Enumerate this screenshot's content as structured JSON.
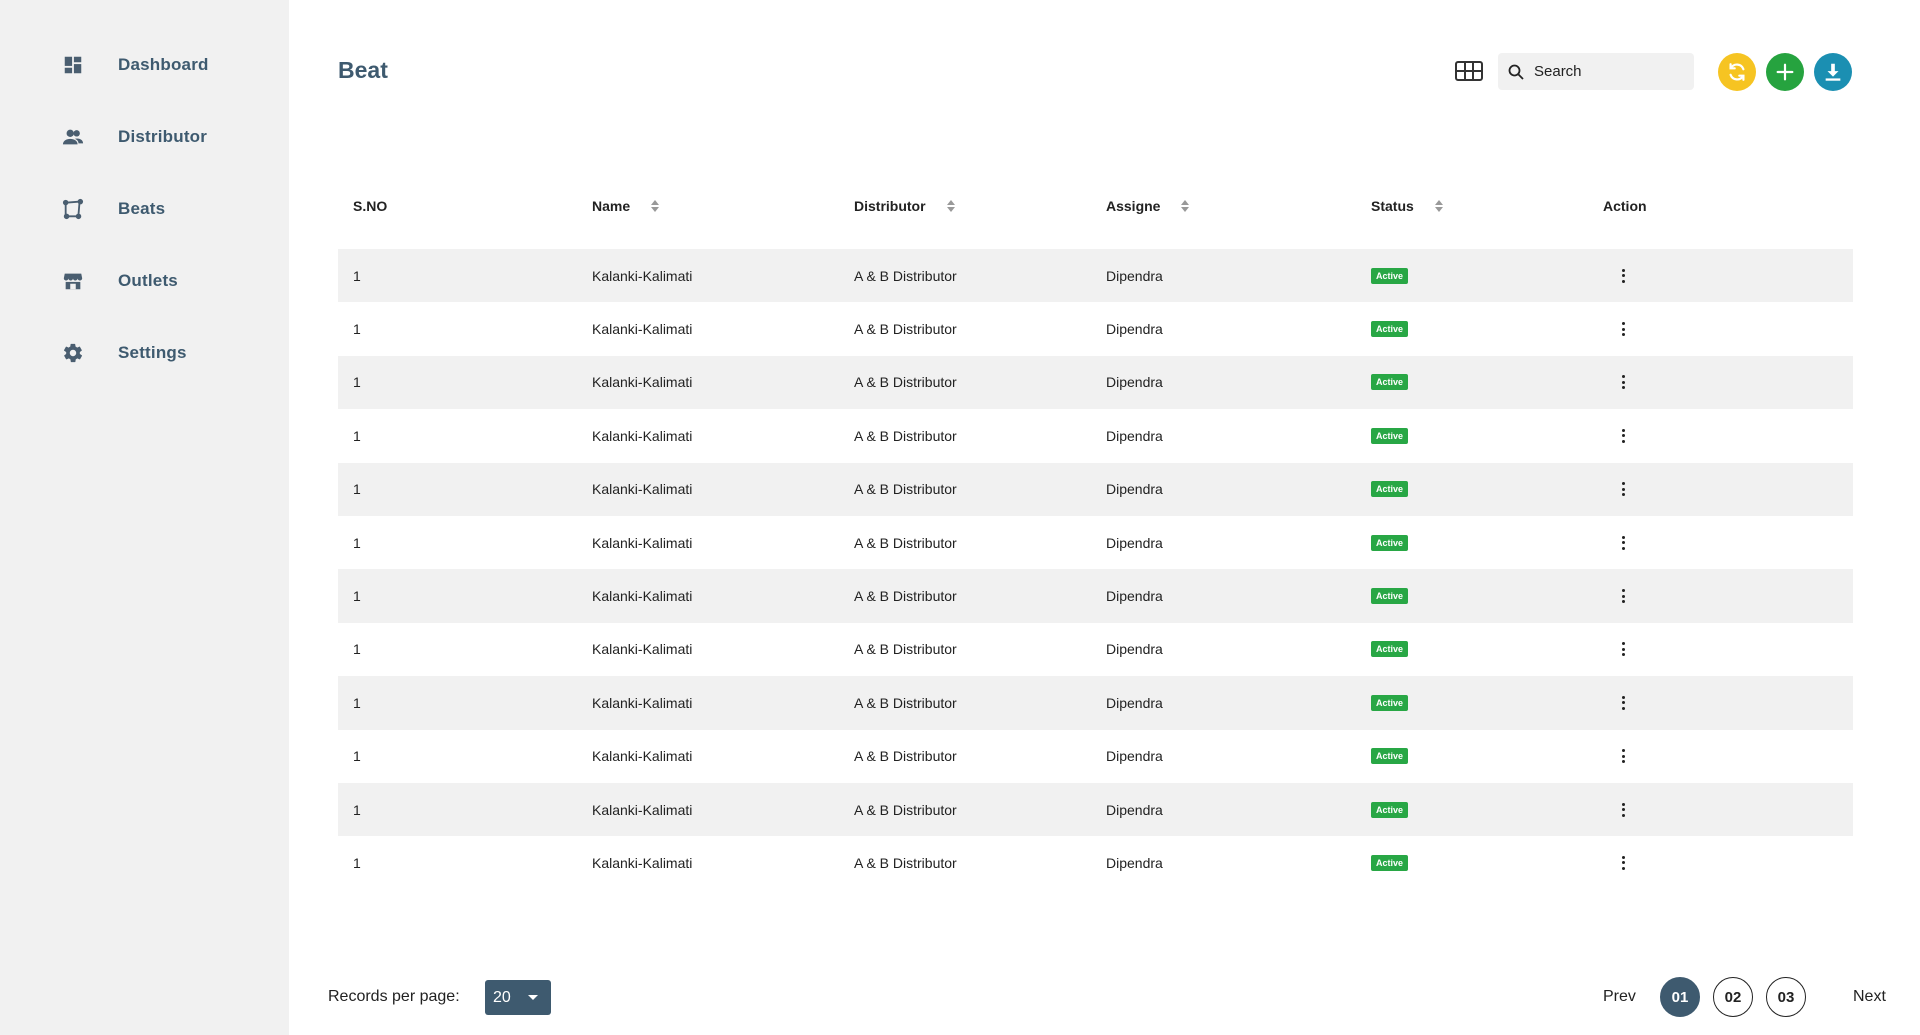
{
  "sidebar": {
    "items": [
      {
        "label": "Dashboard",
        "icon": "dashboard-icon"
      },
      {
        "label": "Distributor",
        "icon": "people-icon"
      },
      {
        "label": "Beats",
        "icon": "route-icon"
      },
      {
        "label": "Outlets",
        "icon": "store-icon"
      },
      {
        "label": "Settings",
        "icon": "gear-icon"
      }
    ]
  },
  "header": {
    "title": "Beat",
    "search_placeholder": "Search",
    "colors": {
      "refresh": "#f6c422",
      "add": "#26a33f",
      "download": "#1b8fb2",
      "brand": "#3e5a6f"
    }
  },
  "table": {
    "columns": [
      "S.NO",
      "Name",
      "Distributor",
      "Assigne",
      "Status",
      "Action"
    ],
    "rows": [
      {
        "sno": "1",
        "name": "Kalanki-Kalimati",
        "distributor": "A & B Distributor",
        "assignee": "Dipendra",
        "status": "Active"
      },
      {
        "sno": "1",
        "name": "Kalanki-Kalimati",
        "distributor": "A & B Distributor",
        "assignee": "Dipendra",
        "status": "Active"
      },
      {
        "sno": "1",
        "name": "Kalanki-Kalimati",
        "distributor": "A & B Distributor",
        "assignee": "Dipendra",
        "status": "Active"
      },
      {
        "sno": "1",
        "name": "Kalanki-Kalimati",
        "distributor": "A & B Distributor",
        "assignee": "Dipendra",
        "status": "Active"
      },
      {
        "sno": "1",
        "name": "Kalanki-Kalimati",
        "distributor": "A & B Distributor",
        "assignee": "Dipendra",
        "status": "Active"
      },
      {
        "sno": "1",
        "name": "Kalanki-Kalimati",
        "distributor": "A & B Distributor",
        "assignee": "Dipendra",
        "status": "Active"
      },
      {
        "sno": "1",
        "name": "Kalanki-Kalimati",
        "distributor": "A & B Distributor",
        "assignee": "Dipendra",
        "status": "Active"
      },
      {
        "sno": "1",
        "name": "Kalanki-Kalimati",
        "distributor": "A & B Distributor",
        "assignee": "Dipendra",
        "status": "Active"
      },
      {
        "sno": "1",
        "name": "Kalanki-Kalimati",
        "distributor": "A & B Distributor",
        "assignee": "Dipendra",
        "status": "Active"
      },
      {
        "sno": "1",
        "name": "Kalanki-Kalimati",
        "distributor": "A & B Distributor",
        "assignee": "Dipendra",
        "status": "Active"
      },
      {
        "sno": "1",
        "name": "Kalanki-Kalimati",
        "distributor": "A & B Distributor",
        "assignee": "Dipendra",
        "status": "Active"
      },
      {
        "sno": "1",
        "name": "Kalanki-Kalimati",
        "distributor": "A & B Distributor",
        "assignee": "Dipendra",
        "status": "Active"
      }
    ]
  },
  "footer": {
    "records_label": "Records per page:",
    "records_value": "20",
    "prev_label": "Prev",
    "next_label": "Next",
    "pages": [
      "01",
      "02",
      "03"
    ],
    "current_page": "01"
  }
}
